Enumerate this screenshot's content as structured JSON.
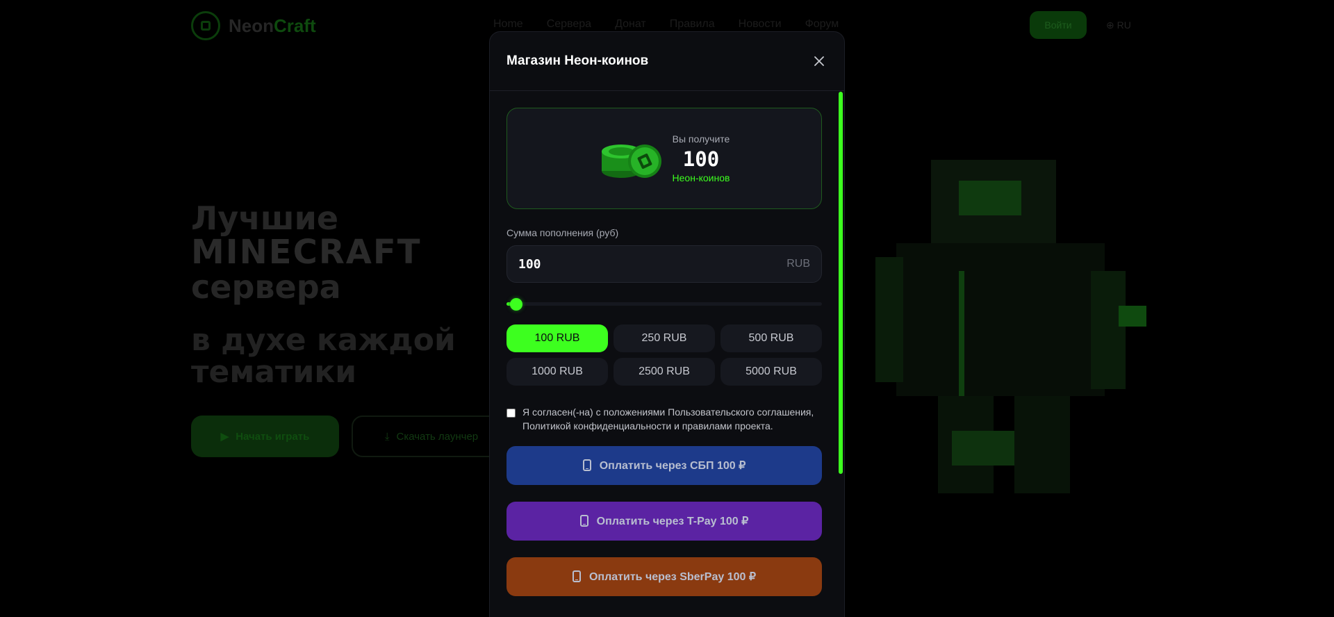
{
  "background": {
    "logo": {
      "brand": "Neon",
      "brand_accent": "Craft"
    },
    "nav": [
      "Home",
      "Сервера",
      "Донат",
      "Правила",
      "Новости",
      "Форум"
    ],
    "login_label": "Войти",
    "lang_label": "RU",
    "hero": {
      "line1": "Лучшие",
      "line2": "MINECRAFT",
      "line3": "сервера",
      "line4": "в духе каждой",
      "line5": "тематики",
      "primary_button": "Начать играть",
      "secondary_button": "Скачать лаунчер"
    }
  },
  "modal": {
    "title": "Магазин Неон-коинов",
    "receive": {
      "label": "Вы получите",
      "amount": "100",
      "unit": "Неон-коинов"
    },
    "amount_field": {
      "label": "Сумма пополнения (руб)",
      "value": "100",
      "suffix": "RUB"
    },
    "slider": {
      "value": 100,
      "min": 100,
      "max": 50000
    },
    "presets": [
      {
        "label": "100 RUB",
        "active": true
      },
      {
        "label": "250 RUB",
        "active": false
      },
      {
        "label": "500 RUB",
        "active": false
      },
      {
        "label": "1000 RUB",
        "active": false
      },
      {
        "label": "2500 RUB",
        "active": false
      },
      {
        "label": "5000 RUB",
        "active": false
      }
    ],
    "agreement": {
      "checked": false,
      "text": "Я согласен(-на) с положениями Пользовательского соглашения, Политикой конфиденциальности и правилами проекта."
    },
    "pay_buttons": [
      {
        "label": "Оплатить через СБП 100 ₽",
        "color": "#1d3a8a"
      },
      {
        "label": "Оплатить через T-Pay 100 ₽",
        "color": "#5b23a3"
      },
      {
        "label": "Оплатить через SberPay 100 ₽",
        "color": "#8a3a10"
      }
    ]
  },
  "colors": {
    "accent": "#3dff1f",
    "modal_bg": "#0c0d11",
    "card_bg": "#14161d"
  }
}
